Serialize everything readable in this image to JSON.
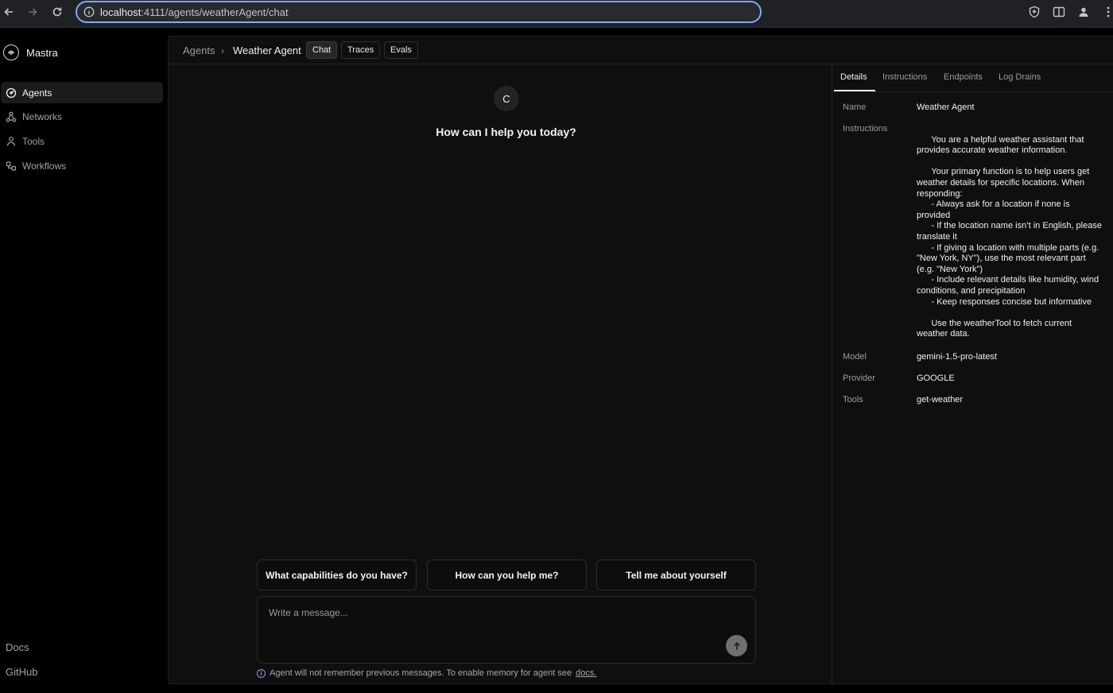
{
  "browser": {
    "url_host": "localhost",
    "url_rest": ":4111/agents/weatherAgent/chat"
  },
  "sidebar": {
    "brand": "Mastra",
    "items": [
      {
        "label": "Agents"
      },
      {
        "label": "Networks"
      },
      {
        "label": "Tools"
      },
      {
        "label": "Workflows"
      }
    ],
    "footer": {
      "docs": "Docs",
      "github": "GitHub"
    }
  },
  "header": {
    "breadcrumb_root": "Agents",
    "breadcrumb_current": "Weather Agent",
    "tabs": [
      {
        "label": "Chat"
      },
      {
        "label": "Traces"
      },
      {
        "label": "Evals"
      }
    ]
  },
  "chat": {
    "avatar_initial": "C",
    "greeting": "How can I help you today?",
    "suggestions": [
      {
        "label": "What capabilities do you have?"
      },
      {
        "label": "How can you help me?"
      },
      {
        "label": "Tell me about yourself"
      }
    ],
    "input_placeholder": "Write a message...",
    "memory_note": "Agent will not remember previous messages. To enable memory for agent see",
    "memory_link": "docs."
  },
  "details": {
    "tabs": [
      {
        "label": "Details"
      },
      {
        "label": "Instructions"
      },
      {
        "label": "Endpoints"
      },
      {
        "label": "Log Drains"
      }
    ],
    "fields": {
      "name_label": "Name",
      "name_value": "Weather Agent",
      "instructions_label": "Instructions",
      "instructions_value": "\n      You are a helpful weather assistant that provides accurate weather information.\n\n      Your primary function is to help users get weather details for specific locations. When responding:\n      - Always ask for a location if none is provided\n      - If the location name isn’t in English, please translate it\n      - If giving a location with multiple parts (e.g. \"New York, NY\"), use the most relevant part (e.g. \"New York\")\n      - Include relevant details like humidity, wind conditions, and precipitation\n      - Keep responses concise but informative\n\n      Use the weatherTool to fetch current weather data.",
      "model_label": "Model",
      "model_value": "gemini-1.5-pro-latest",
      "provider_label": "Provider",
      "provider_value": "GOOGLE",
      "tools_label": "Tools",
      "tools_value": "get-weather"
    }
  }
}
